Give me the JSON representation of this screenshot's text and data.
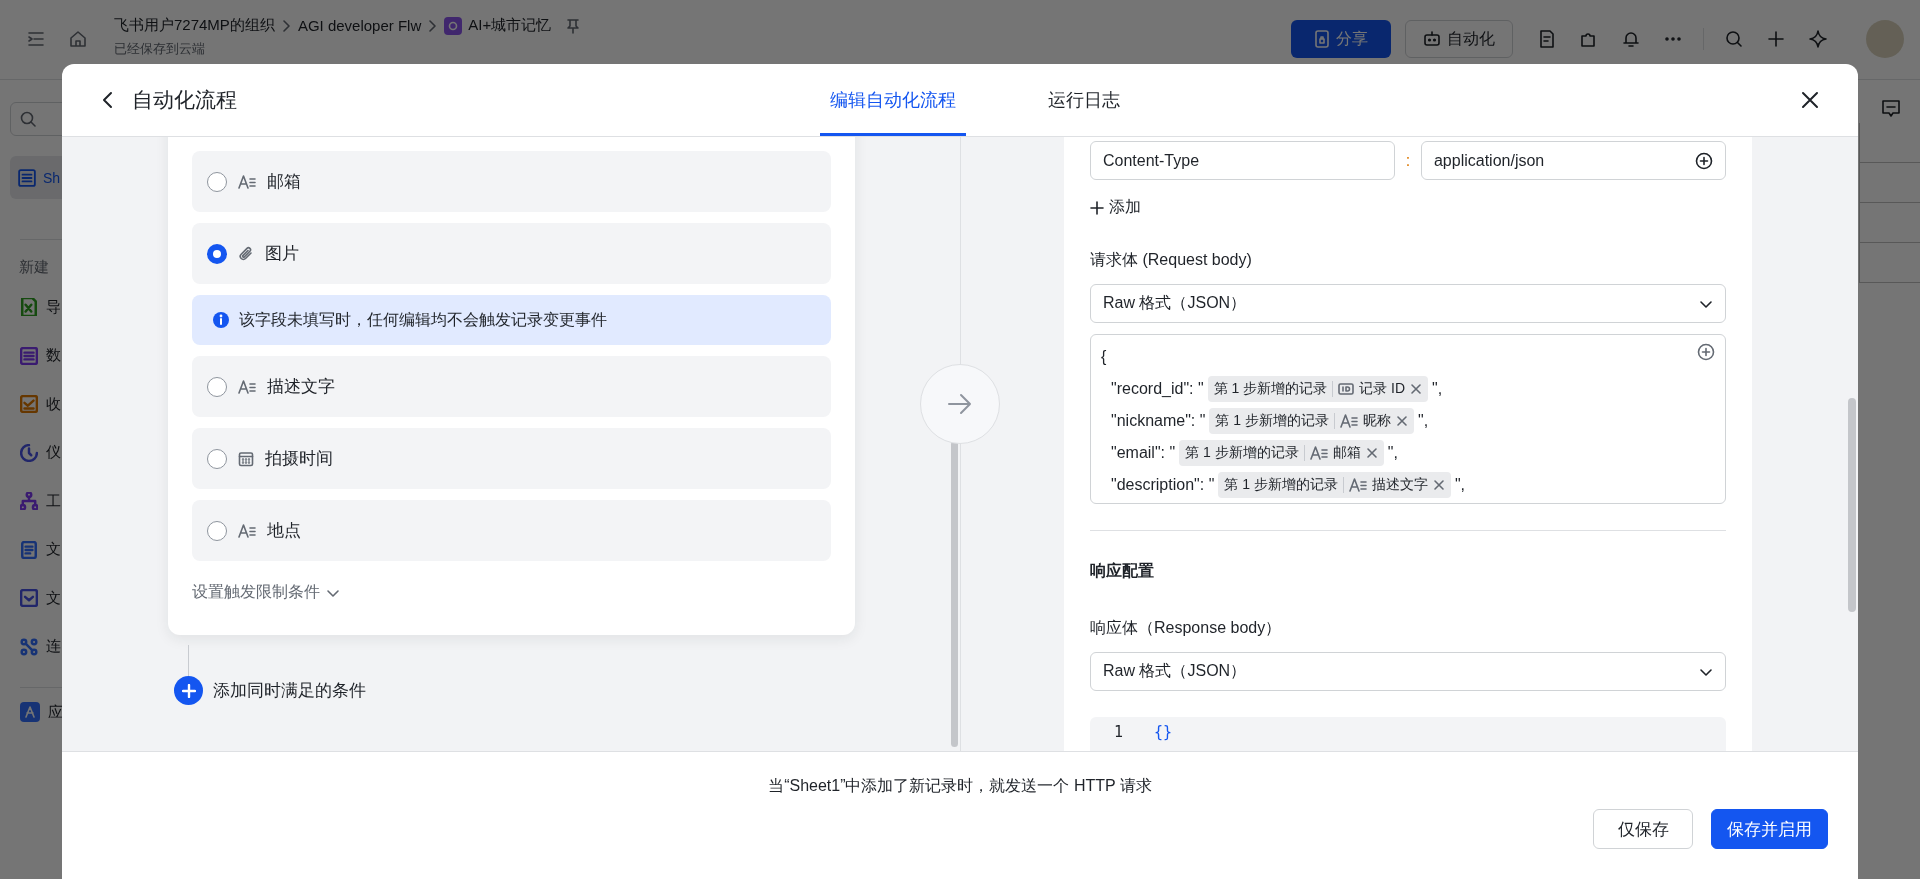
{
  "app_bar": {
    "breadcrumbs": [
      {
        "text": "飞书用户7274MP的组织",
        "kind": "plain"
      },
      {
        "text": "AGI developer Flw",
        "kind": "plain"
      },
      {
        "text": "AI+城市记忆",
        "kind": "base"
      }
    ],
    "save_status": "已经保存到云端",
    "share_button": "分享",
    "automation_button": "自动化"
  },
  "sidebar": {
    "items": [
      {
        "label": "Sh",
        "selected": true
      }
    ],
    "new_section": {
      "title": "新建",
      "items": [
        {
          "label": "导",
          "kind": "excel"
        },
        {
          "label": "数",
          "kind": "table"
        },
        {
          "label": "收",
          "kind": "form"
        },
        {
          "label": "仪",
          "kind": "dashboard"
        },
        {
          "label": "工",
          "kind": "workflow"
        },
        {
          "label": "文",
          "kind": "doc"
        },
        {
          "label": "文",
          "kind": "folder"
        },
        {
          "label": "连",
          "kind": "connect"
        }
      ]
    },
    "app_item": "应"
  },
  "modal": {
    "title": "自动化流程",
    "tabs": [
      {
        "label": "编辑自动化流程",
        "selected": true
      },
      {
        "label": "运行日志",
        "selected": false
      }
    ],
    "trigger": {
      "fields": [
        {
          "kind": "text",
          "label": "邮箱",
          "selected": false
        },
        {
          "kind": "attachment",
          "label": "图片",
          "selected": true
        },
        {
          "kind": "notice",
          "text": "该字段未填写时，任何编辑均不会触发记录变更事件"
        },
        {
          "kind": "text",
          "label": "描述文字",
          "selected": false
        },
        {
          "kind": "date",
          "label": "拍摄时间",
          "selected": false
        },
        {
          "kind": "text",
          "label": "地点",
          "selected": false
        }
      ],
      "limit_toggle": "设置触发限制条件",
      "add_condition": "添加同时满足的条件"
    },
    "http": {
      "headers": [
        {
          "key": "Content-Type",
          "separator": ":",
          "value": "application/json"
        }
      ],
      "add_header": "添加",
      "request_label": "请求体 (Request body)",
      "request_format": "Raw 格式（JSON）",
      "body_open": "{",
      "body_lines": [
        {
          "key": "\"record_id\": \"",
          "source": "第 1 步新增的记录",
          "field": {
            "kind": "id",
            "label": "记录 ID"
          },
          "tail": "\","
        },
        {
          "key": "\"nickname\": \"",
          "source": "第 1 步新增的记录",
          "field": {
            "kind": "text",
            "label": "昵称"
          },
          "tail": "\","
        },
        {
          "key": "\"email\": \"",
          "source": "第 1 步新增的记录",
          "field": {
            "kind": "text",
            "label": "邮箱"
          },
          "tail": "\","
        },
        {
          "key": "\"description\": \"",
          "source": "第 1 步新增的记录",
          "field": {
            "kind": "text",
            "label": "描述文字"
          },
          "tail": "\","
        }
      ],
      "response_title": "响应配置",
      "response_label": "响应体（Response body）",
      "response_format": "Raw 格式（JSON）",
      "response_code": [
        {
          "line": "1",
          "code": "{}"
        }
      ]
    },
    "summary": "当“Sheet1”中添加了新记录时，就发送一个 HTTP 请求",
    "buttons": [
      {
        "label": "仅保存",
        "kind": "secondary"
      },
      {
        "label": "保存并启用",
        "kind": "primary"
      }
    ]
  }
}
